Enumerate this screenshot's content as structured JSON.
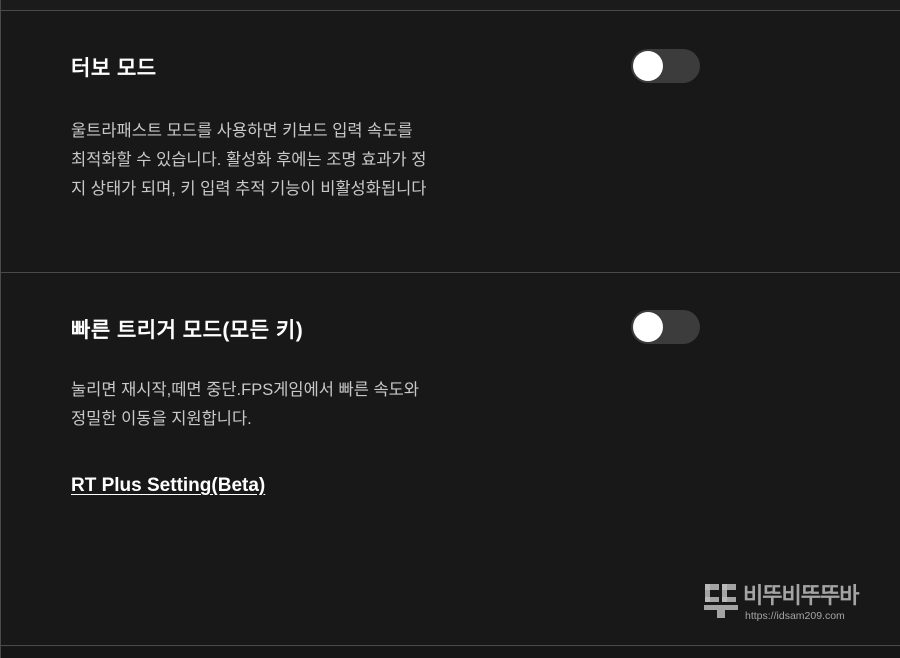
{
  "turbo": {
    "title": "터보 모드",
    "toggle_on": false,
    "description": "울트라패스트 모드를 사용하면 키보드 입력 속도를\n최적화할 수 있습니다. 활성화 후에는 조명 효과가 정\n지 상태가 되며, 키 입력 추적 기능이 비활성화됩니다"
  },
  "trigger": {
    "title": "빠른 트리거 모드(모든 키)",
    "toggle_on": false,
    "description": "눌리면 재시작,떼면 중단.FPS게임에서 빠른 속도와\n정밀한 이동을 지원합니다.",
    "link_label": "RT Plus Setting(Beta)"
  },
  "watermark": {
    "name": "비뚜비뚜뚜바",
    "url": "https://idsam209.com"
  },
  "colors": {
    "background": "#181818",
    "divider": "#4a4a4a",
    "toggle_track": "#3c3c3c",
    "toggle_knob": "#ffffff",
    "text_primary": "#ffffff",
    "text_secondary": "#c8c8c8"
  }
}
